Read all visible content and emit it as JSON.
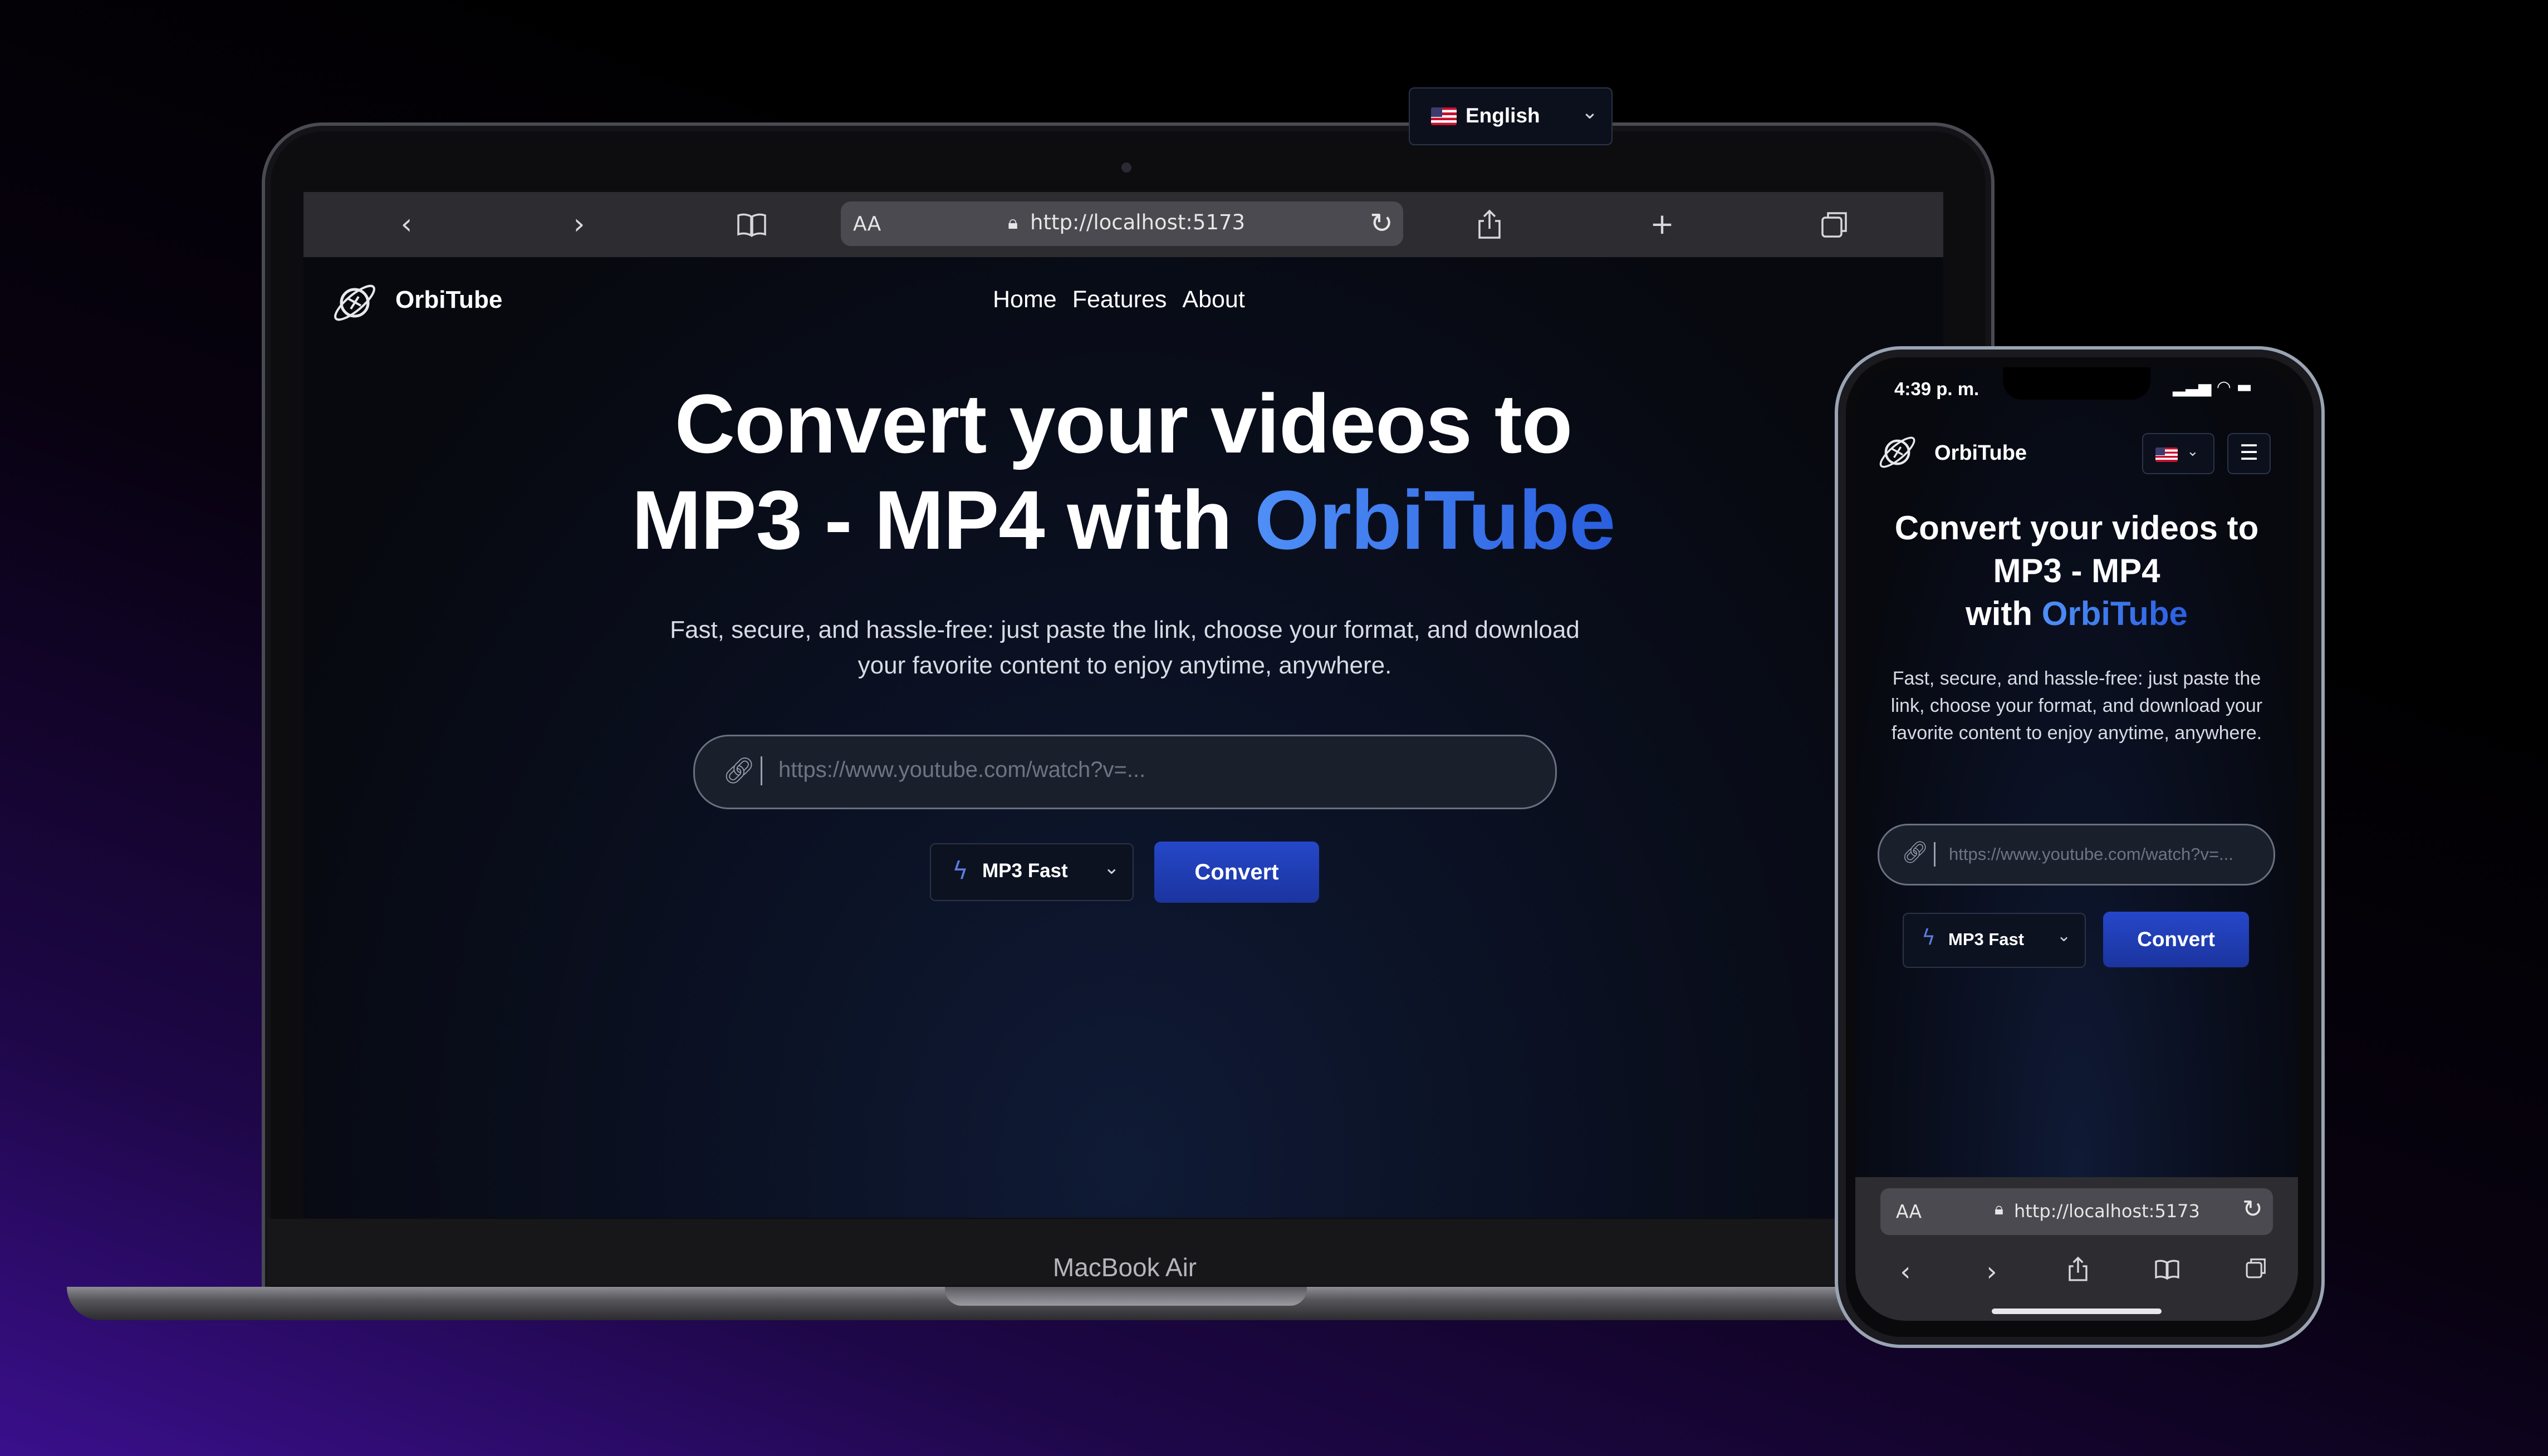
{
  "desktop": {
    "device_label": "MacBook Air",
    "browser": {
      "url": "http://localhost:5173",
      "text_size_label": "AA",
      "icons": [
        "back-icon",
        "forward-icon",
        "bookmarks-icon",
        "share-icon",
        "new-tab-icon",
        "tabs-icon",
        "reload-icon",
        "lock-icon"
      ]
    },
    "site": {
      "brand": "OrbiTube",
      "nav": [
        "Home",
        "Features",
        "About"
      ],
      "language": "English",
      "hero_line1": "Convert your videos to",
      "hero_line2_prefix": "MP3 - MP4 with ",
      "hero_accent": "OrbiTube",
      "subtitle": "Fast, secure, and hassle-free: just paste the link, choose your format, and download your favorite content to enjoy anytime, anywhere.",
      "input_placeholder": "https://www.youtube.com/watch?v=...",
      "format": "MP3 Fast",
      "convert_label": "Convert"
    }
  },
  "mobile": {
    "time": "4:39 p. m.",
    "browser": {
      "url": "http://localhost:5173",
      "text_size_label": "AA"
    },
    "site": {
      "brand": "OrbiTube",
      "hero_line1": "Convert your videos to",
      "hero_line2": "MP3 - MP4",
      "hero_line3_prefix": "with ",
      "hero_accent": "OrbiTube",
      "subtitle": "Fast, secure, and hassle-free: just paste the link, choose your format, and download your favorite content to enjoy anytime, anywhere.",
      "input_placeholder": "https://www.youtube.com/watch?v=...",
      "format": "MP3 Fast",
      "convert_label": "Convert"
    }
  },
  "colors": {
    "accent_blue": "#3b6ff0",
    "button_blue": "#2547c9",
    "page_bg": "#07090f",
    "backdrop_purple": "#3a0f8c"
  }
}
